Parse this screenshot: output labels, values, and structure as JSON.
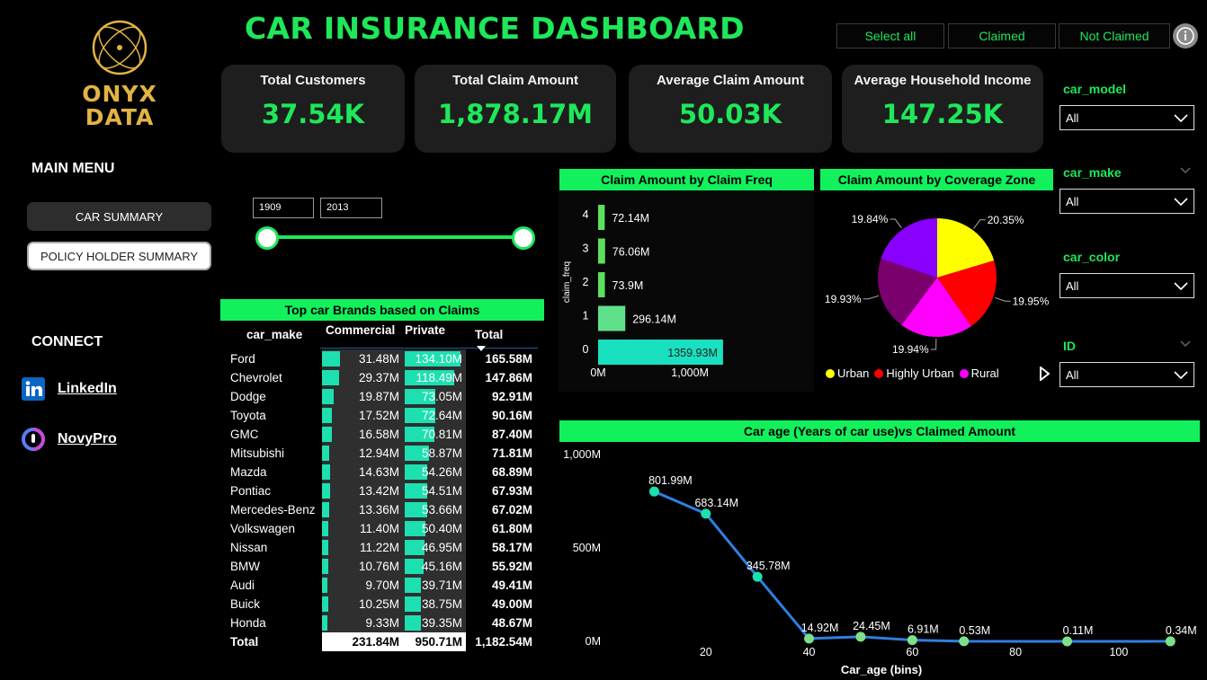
{
  "logo": {
    "line1": "ONYX",
    "line2": "DATA"
  },
  "title": "CAR INSURANCE DASHBOARD",
  "top_buttons": [
    "Select all",
    "Claimed",
    "Not Claimed"
  ],
  "kpis": [
    {
      "label": "Total Customers",
      "value": "37.54K"
    },
    {
      "label": "Total Claim Amount",
      "value": "1,878.17M"
    },
    {
      "label": "Average Claim Amount",
      "value": "50.03K"
    },
    {
      "label": "Average Household Income",
      "value": "147.25K"
    }
  ],
  "menu": {
    "title": "MAIN MENU",
    "car_summary": "CAR SUMMARY",
    "policy_holder_summary": "POLICY HOLDER SUMMARY"
  },
  "connect": {
    "title": "CONNECT",
    "linkedin": "LinkedIn",
    "novypro": "NovyPro"
  },
  "year_slider": {
    "start": "1909",
    "end": "2013"
  },
  "brands_table": {
    "title": "Top car Brands based on Claims",
    "headers": [
      "car_make",
      "Commercial",
      "Private",
      "Total"
    ],
    "rows": [
      [
        "Ford",
        "31.48M",
        "134.10M",
        "165.58M"
      ],
      [
        "Chevrolet",
        "29.37M",
        "118.49M",
        "147.86M"
      ],
      [
        "Dodge",
        "19.87M",
        "73.05M",
        "92.91M"
      ],
      [
        "Toyota",
        "17.52M",
        "72.64M",
        "90.16M"
      ],
      [
        "GMC",
        "16.58M",
        "70.81M",
        "87.40M"
      ],
      [
        "Mitsubishi",
        "12.94M",
        "58.87M",
        "71.81M"
      ],
      [
        "Mazda",
        "14.63M",
        "54.26M",
        "68.89M"
      ],
      [
        "Pontiac",
        "13.42M",
        "54.51M",
        "67.93M"
      ],
      [
        "Mercedes-Benz",
        "13.36M",
        "53.66M",
        "67.02M"
      ],
      [
        "Volkswagen",
        "11.40M",
        "50.40M",
        "61.80M"
      ],
      [
        "Nissan",
        "11.22M",
        "46.95M",
        "58.17M"
      ],
      [
        "BMW",
        "10.76M",
        "45.16M",
        "55.92M"
      ],
      [
        "Audi",
        "9.70M",
        "39.71M",
        "49.41M"
      ],
      [
        "Buick",
        "10.25M",
        "38.75M",
        "49.00M"
      ],
      [
        "Honda",
        "9.33M",
        "39.35M",
        "48.67M"
      ]
    ],
    "total": [
      "Total",
      "231.84M",
      "950.71M",
      "1,182.54M"
    ]
  },
  "claim_freq_chart": {
    "title": "Claim Amount by Claim Freq",
    "ylabel": "claim_freq",
    "x_ticks": [
      "0M",
      "1,000M"
    ],
    "xmax": 2350,
    "bars": [
      {
        "cat": "4",
        "value": 72.14,
        "label": "72.14M",
        "color": "#5de05d"
      },
      {
        "cat": "3",
        "value": 76.06,
        "label": "76.06M",
        "color": "#5de05d"
      },
      {
        "cat": "2",
        "value": 73.9,
        "label": "73.9M",
        "color": "#5de05d"
      },
      {
        "cat": "1",
        "value": 296.14,
        "label": "296.14M",
        "color": "#5fe08a"
      },
      {
        "cat": "0",
        "value": 1359.93,
        "label": "1359.93M",
        "color": "#18e0c0"
      }
    ]
  },
  "coverage_chart": {
    "title": "Claim Amount by Coverage Zone",
    "slices": [
      {
        "pct": 20.35,
        "label": "20.35%",
        "color": "#ffff00"
      },
      {
        "pct": 19.95,
        "label": "19.95%",
        "color": "#ff0000"
      },
      {
        "pct": 19.94,
        "label": "19.94%",
        "color": "#ff00ff"
      },
      {
        "pct": 19.93,
        "label": "19.93%",
        "color": "#7a006e"
      },
      {
        "pct": 19.84,
        "label": "19.84%",
        "color": "#8a00ff"
      }
    ],
    "legend": [
      {
        "name": "Urban",
        "color": "#ffff00"
      },
      {
        "name": "Highly Urban",
        "color": "#ff0000"
      },
      {
        "name": "Rural",
        "color": "#ff00ff"
      }
    ]
  },
  "slicers": [
    {
      "label": "car_model",
      "value": "All"
    },
    {
      "label": "car_make",
      "value": "All"
    },
    {
      "label": "car_color",
      "value": "All"
    },
    {
      "label": "ID",
      "value": "All"
    }
  ],
  "age_chart": {
    "title": "Car age (Years of car use)vs Claimed Amount",
    "xlabel": "Car_age (bins)",
    "y_ticks": [
      "1,000M",
      "500M",
      "0M"
    ],
    "x_ticks": [
      "20",
      "40",
      "60",
      "80",
      "100"
    ],
    "xlim": [
      0,
      115
    ],
    "ylim": [
      0,
      1000
    ],
    "points": [
      {
        "x": 10,
        "y": 801.99,
        "label": "801.99M"
      },
      {
        "x": 20,
        "y": 683.14,
        "label": "683.14M"
      },
      {
        "x": 30,
        "y": 345.78,
        "label": "345.78M"
      },
      {
        "x": 40,
        "y": 14.92,
        "label": "14.92M"
      },
      {
        "x": 50,
        "y": 24.45,
        "label": "24.45M"
      },
      {
        "x": 60,
        "y": 6.91,
        "label": "6.91M"
      },
      {
        "x": 70,
        "y": 0.53,
        "label": "0.53M"
      },
      {
        "x": 90,
        "y": 0.11,
        "label": "0.11M"
      },
      {
        "x": 110,
        "y": 0.34,
        "label": "0.34M"
      }
    ]
  }
}
